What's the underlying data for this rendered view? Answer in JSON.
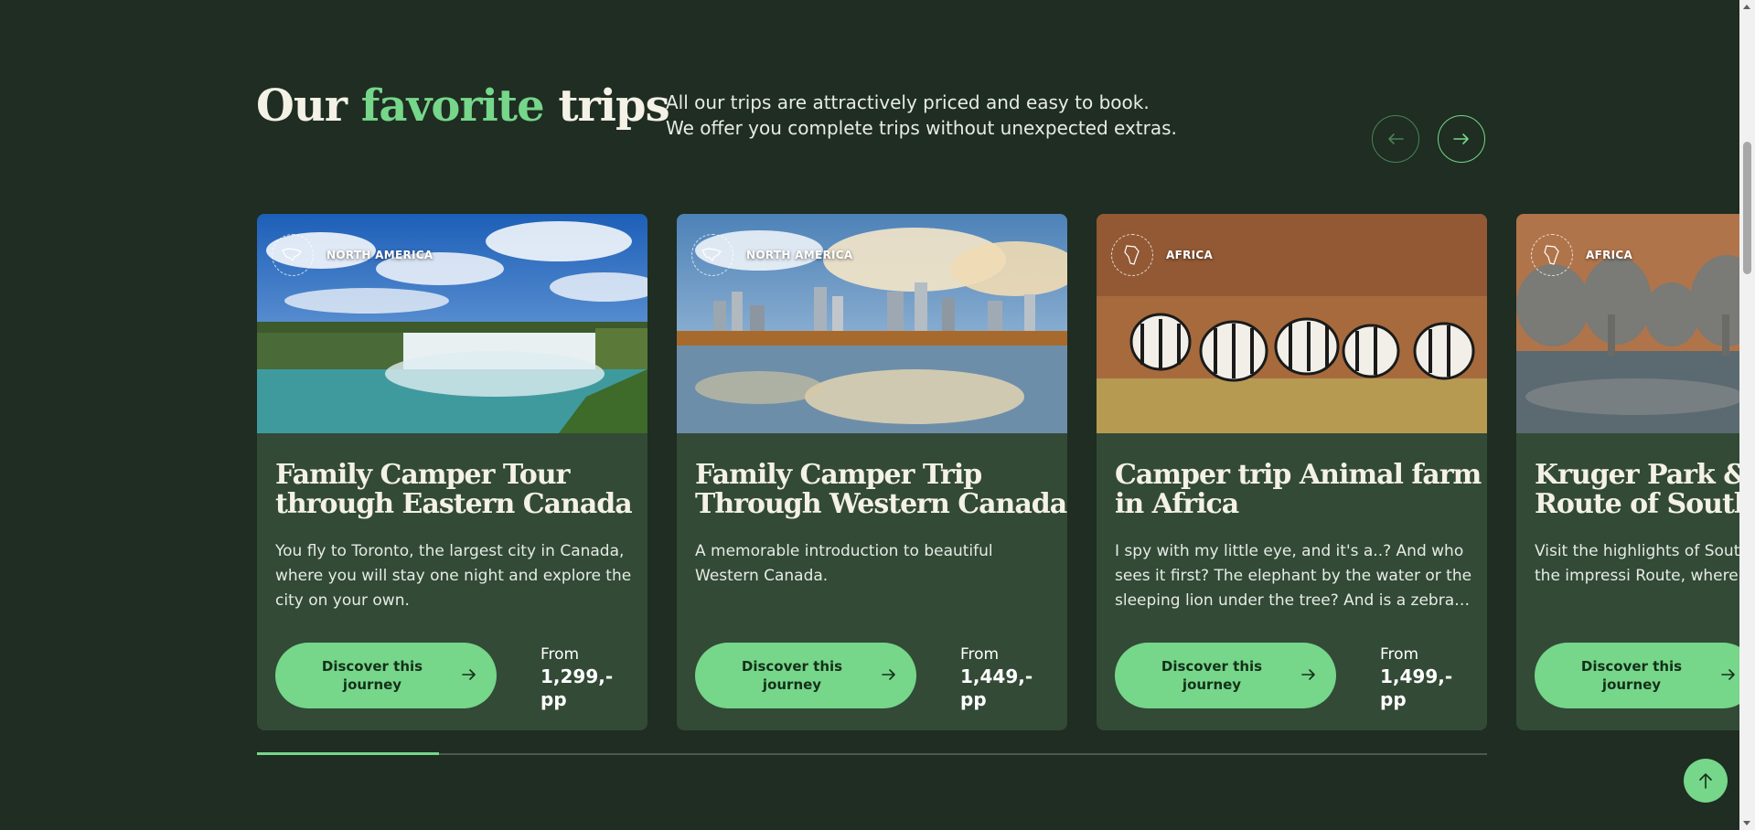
{
  "heading": {
    "part1": "Our",
    "highlight": "favorite",
    "part2": "trips"
  },
  "intro": "All our trips are attractively priced and easy to book. We offer you complete trips without unexpected extras.",
  "carousel": {
    "progress_fraction": 0.148
  },
  "cards": [
    {
      "region": "NORTH AMERICA",
      "region_icon": "north-america-map-icon",
      "image": "niagara-falls-photo",
      "title_line1": "Family Camper Tour",
      "title_line2": "through Eastern Canada",
      "description": "You fly to Toronto, the largest city in Canada, where you will stay one night and explore the city on your own.",
      "cta": "Discover this journey",
      "from": "From",
      "price": "1,299,- pp"
    },
    {
      "region": "NORTH AMERICA",
      "region_icon": "north-america-map-icon",
      "image": "vancouver-skyline-photo",
      "title_line1": "Family Camper Trip",
      "title_line2": "Through Western Canada",
      "description": "A memorable introduction to beautiful Western Canada.",
      "cta": "Discover this journey",
      "from": "From",
      "price": "1,449,- pp"
    },
    {
      "region": "AFRICA",
      "region_icon": "africa-map-icon",
      "image": "zebras-photo",
      "title_line1": "Camper trip Animal farm",
      "title_line2": "in Africa",
      "description": "I spy with my little eye, and it's a..? And who sees it first? The elephant by the water or the sleeping lion under the tree? And is a zebra…",
      "cta": "Discover this journey",
      "from": "From",
      "price": "1,499,- pp"
    },
    {
      "region": "AFRICA",
      "region_icon": "africa-map-icon",
      "image": "elephants-photo",
      "title_line1": "Kruger Park & G",
      "title_line2": "Route of South A",
      "description": "Visit the highlights of South trip. You follow the impressi Route, where you can enjoy",
      "cta": "Discover this journey"
    }
  ],
  "colors": {
    "background": "#1f2d22",
    "card": "#324a36",
    "accent": "#76d68a",
    "cream": "#f4f1e6"
  }
}
